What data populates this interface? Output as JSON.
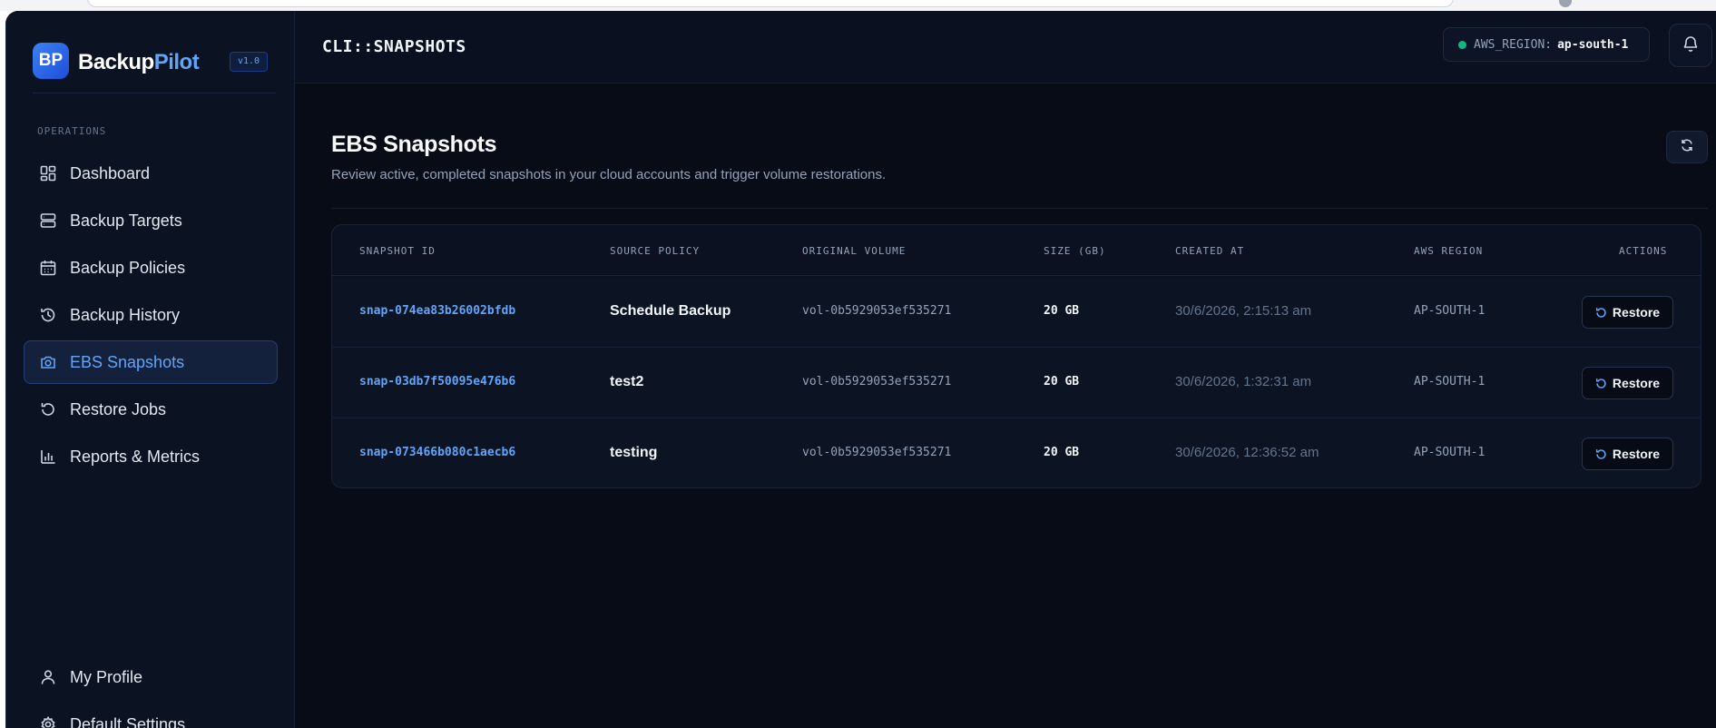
{
  "app": {
    "logo_text": "BP",
    "name_part1": "Backup",
    "name_part2": "Pilot",
    "version": "v1.0"
  },
  "sidebar": {
    "section_label": "OPERATIONS",
    "items": [
      {
        "label": "Dashboard",
        "icon": "dashboard-icon",
        "active": false
      },
      {
        "label": "Backup Targets",
        "icon": "server-icon",
        "active": false
      },
      {
        "label": "Backup Policies",
        "icon": "calendar-icon",
        "active": false
      },
      {
        "label": "Backup History",
        "icon": "history-icon",
        "active": false
      },
      {
        "label": "EBS Snapshots",
        "icon": "camera-icon",
        "active": true
      },
      {
        "label": "Restore Jobs",
        "icon": "restore-icon",
        "active": false
      },
      {
        "label": "Reports & Metrics",
        "icon": "bar-chart-icon",
        "active": false
      }
    ],
    "bottom_items": [
      {
        "label": "My Profile",
        "icon": "user-icon"
      },
      {
        "label": "Default Settings",
        "icon": "gear-icon"
      }
    ]
  },
  "header": {
    "title": "CLI::SNAPSHOTS",
    "region_label": "AWS_REGION:",
    "region_value": "ap-south-1",
    "region_status_color": "#10b981"
  },
  "page": {
    "title": "EBS Snapshots",
    "subtitle": "Review active, completed snapshots in your cloud accounts and trigger volume restorations."
  },
  "table": {
    "columns": [
      "SNAPSHOT ID",
      "SOURCE POLICY",
      "ORIGINAL VOLUME",
      "SIZE (GB)",
      "CREATED AT",
      "AWS REGION",
      "ACTIONS"
    ],
    "rows": [
      {
        "id": "snap-074ea83b26002bfdb",
        "policy": "Schedule Backup",
        "volume": "vol-0b5929053ef535271",
        "size": "20 GB",
        "created": "30/6/2026, 2:15:13 am",
        "region": "AP-SOUTH-1",
        "action": "Restore"
      },
      {
        "id": "snap-03db7f50095e476b6",
        "policy": "test2",
        "volume": "vol-0b5929053ef535271",
        "size": "20 GB",
        "created": "30/6/2026, 1:32:31 am",
        "region": "AP-SOUTH-1",
        "action": "Restore"
      },
      {
        "id": "snap-073466b080c1aecb6",
        "policy": "testing",
        "volume": "vol-0b5929053ef535271",
        "size": "20 GB",
        "created": "30/6/2026, 12:36:52 am",
        "region": "AP-SOUTH-1",
        "action": "Restore"
      }
    ]
  },
  "colors": {
    "accent": "#60a5fa",
    "background": "#080c17",
    "sidebar": "#0b1222"
  }
}
